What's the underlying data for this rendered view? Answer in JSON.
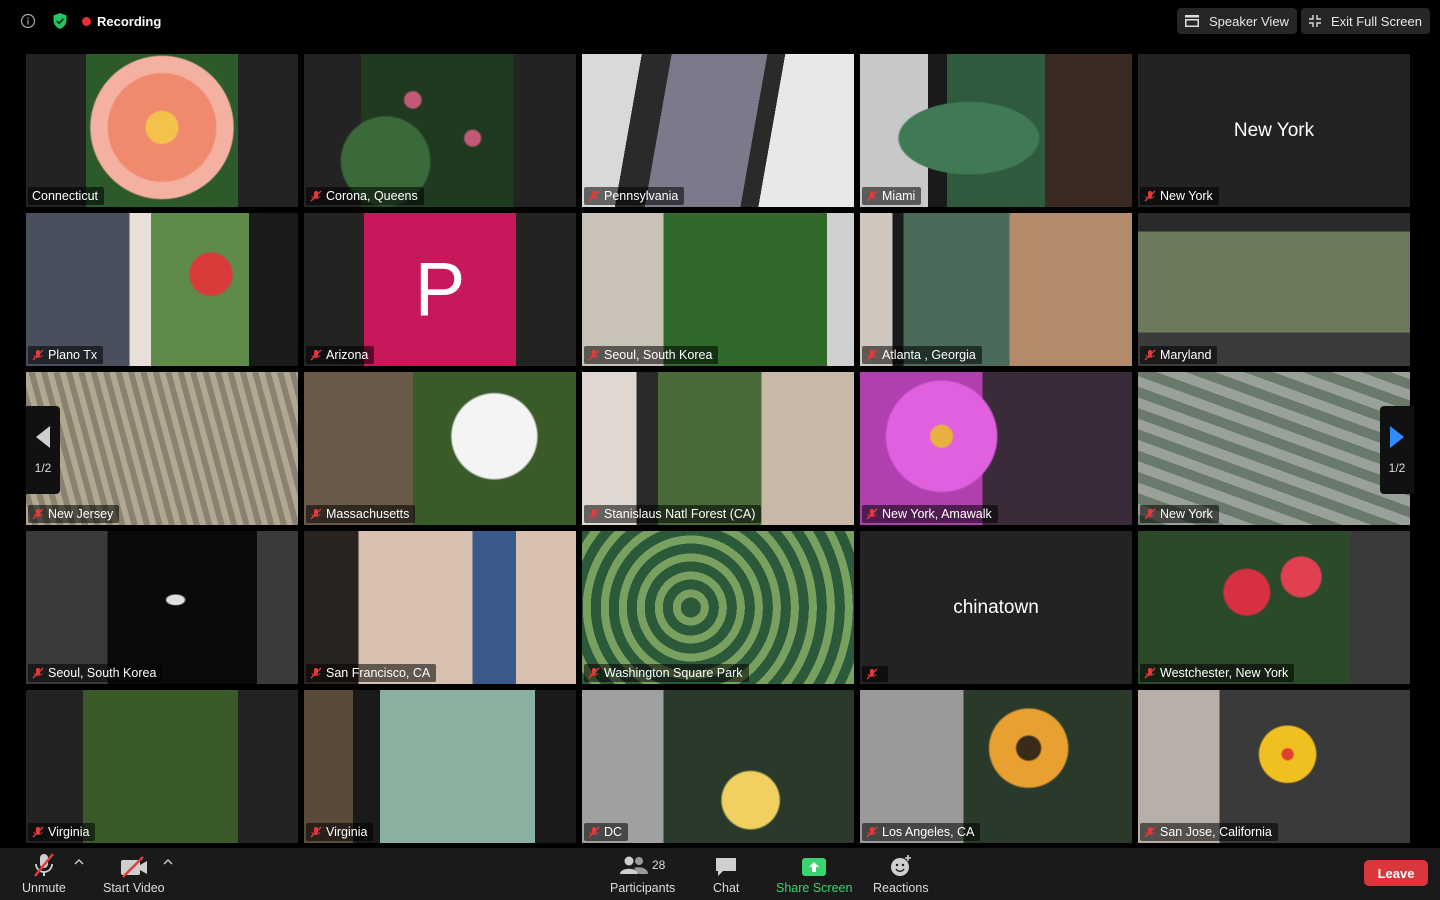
{
  "topbar": {
    "recording_label": "Recording",
    "speaker_view_label": "Speaker View",
    "exit_fullscreen_label": "Exit Full Screen"
  },
  "pager": {
    "left_label": "1/2",
    "right_label": "1/2"
  },
  "tiles": [
    {
      "name": "Connecticut",
      "muted": false,
      "bg": "flower-orange",
      "active": true
    },
    {
      "name": "Corona, Queens",
      "muted": true,
      "bg": "leaves-pink"
    },
    {
      "name": "Pennsylvania",
      "muted": true,
      "bg": "phone-white"
    },
    {
      "name": "Miami",
      "muted": true,
      "bg": "phone-green"
    },
    {
      "name": "New York",
      "muted": true,
      "bg": "plain",
      "big": "New York"
    },
    {
      "name": "Plano Tx",
      "muted": true,
      "bg": "phone-red"
    },
    {
      "name": "Arizona",
      "muted": true,
      "bg": "avatar",
      "avatar": "P"
    },
    {
      "name": "Seoul, South Korea",
      "muted": true,
      "bg": "grass"
    },
    {
      "name": "Atlanta , Georgia",
      "muted": true,
      "bg": "phone-tree"
    },
    {
      "name": "Maryland",
      "muted": true,
      "bg": "phone-trees"
    },
    {
      "name": "New Jersey",
      "muted": true,
      "bg": "fence"
    },
    {
      "name": "Massachusetts",
      "muted": true,
      "bg": "white-flower"
    },
    {
      "name": "Stanislaus Natl Forest (CA)",
      "muted": true,
      "bg": "phone-plants"
    },
    {
      "name": "New York, Amawalk",
      "muted": true,
      "bg": "zinnia"
    },
    {
      "name": "New York",
      "muted": true,
      "bg": "ivy"
    },
    {
      "name": "Seoul, South Korea",
      "muted": true,
      "bg": "grass-dark"
    },
    {
      "name": "San Francisco, CA",
      "muted": true,
      "bg": "selfie-phone"
    },
    {
      "name": "Washington Square Park",
      "muted": true,
      "bg": "hosta"
    },
    {
      "name": "",
      "muted": true,
      "bg": "plain",
      "big": "chinatown"
    },
    {
      "name": "Westchester, New York",
      "muted": true,
      "bg": "red-flowers"
    },
    {
      "name": "Virginia",
      "muted": true,
      "bg": "shrub"
    },
    {
      "name": "Virginia",
      "muted": true,
      "bg": "mimosa"
    },
    {
      "name": "DC",
      "muted": true,
      "bg": "lantana"
    },
    {
      "name": "Los Angeles, CA",
      "muted": true,
      "bg": "sunflower"
    },
    {
      "name": "San Jose, California",
      "muted": true,
      "bg": "hibiscus"
    }
  ],
  "bottombar": {
    "unmute_label": "Unmute",
    "start_video_label": "Start Video",
    "participants_label": "Participants",
    "participants_count": "28",
    "chat_label": "Chat",
    "share_screen_label": "Share Screen",
    "reactions_label": "Reactions",
    "leave_label": "Leave"
  },
  "colors": {
    "active_border": "#e7eb89",
    "leave": "#d9373b",
    "share_green": "#3ad471",
    "avatar": "#c8185c"
  }
}
